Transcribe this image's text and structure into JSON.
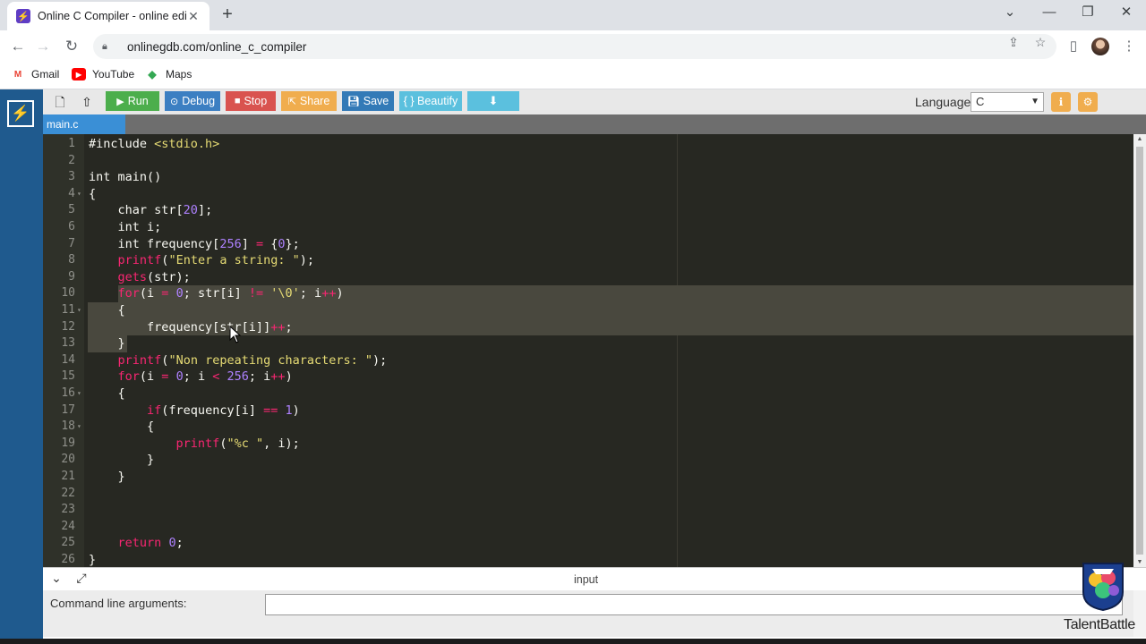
{
  "browser": {
    "tab_title": "Online C Compiler - online editor",
    "tab_close": "✕",
    "new_tab": "+",
    "url": "onlinegdb.com/online_c_compiler",
    "bookmarks": [
      {
        "label": "Gmail",
        "icon": "gmail-icon"
      },
      {
        "label": "YouTube",
        "icon": "youtube-icon"
      },
      {
        "label": "Maps",
        "icon": "maps-icon"
      }
    ],
    "colors": {
      "tabbar": "#dee1e6",
      "omnibox": "#f1f3f4"
    }
  },
  "app": {
    "toolbar": {
      "run": "Run",
      "debug": "Debug",
      "stop": "Stop",
      "share": "Share",
      "save": "Save",
      "beautify": "{ } Beautify",
      "language_label": "Language",
      "language_value": "C"
    },
    "file_tab": "main.c",
    "colors": {
      "sidebar": "#1f5a8e",
      "run": "#4cae4c",
      "debug": "#3c7fc2",
      "stop": "#d9534f",
      "share": "#f0ad4e",
      "save": "#337ab7",
      "beautify": "#5bc0de",
      "download": "#5bc0de",
      "editor_bg": "#272822",
      "selection": "#49483e"
    },
    "editor": {
      "selected_lines": [
        10,
        11,
        12,
        13
      ],
      "lines": [
        {
          "n": "1",
          "fold": "",
          "segs": [
            [
              "k",
              "#include "
            ],
            [
              "str",
              "<stdio.h>"
            ]
          ]
        },
        {
          "n": "2",
          "fold": "",
          "segs": []
        },
        {
          "n": "3",
          "fold": "",
          "segs": [
            [
              "k",
              "int main()"
            ]
          ]
        },
        {
          "n": "4",
          "fold": "▾",
          "segs": [
            [
              "k",
              "{"
            ]
          ]
        },
        {
          "n": "5",
          "fold": "",
          "segs": [
            [
              "k",
              "    char str["
            ],
            [
              "num",
              "20"
            ],
            [
              "k",
              "];"
            ]
          ]
        },
        {
          "n": "6",
          "fold": "",
          "segs": [
            [
              "k",
              "    int i;"
            ]
          ]
        },
        {
          "n": "7",
          "fold": "",
          "segs": [
            [
              "k",
              "    int frequency["
            ],
            [
              "num",
              "256"
            ],
            [
              "k",
              "] "
            ],
            [
              "op",
              "="
            ],
            [
              "k",
              " {"
            ],
            [
              "num",
              "0"
            ],
            [
              "k",
              "};"
            ]
          ]
        },
        {
          "n": "8",
          "fold": "",
          "segs": [
            [
              "k",
              "    "
            ],
            [
              "fn",
              "printf"
            ],
            [
              "k",
              "("
            ],
            [
              "str",
              "\"Enter a string: \""
            ],
            [
              "k",
              ");"
            ]
          ]
        },
        {
          "n": "9",
          "fold": "",
          "segs": [
            [
              "k",
              "    "
            ],
            [
              "fn",
              "gets"
            ],
            [
              "k",
              "(str);"
            ]
          ]
        },
        {
          "n": "10",
          "fold": "",
          "segs": [
            [
              "k",
              "    "
            ],
            [
              "kw",
              "for"
            ],
            [
              "k",
              "(i "
            ],
            [
              "op",
              "="
            ],
            [
              "k",
              " "
            ],
            [
              "num",
              "0"
            ],
            [
              "k",
              "; str[i] "
            ],
            [
              "op",
              "!="
            ],
            [
              "k",
              " "
            ],
            [
              "str",
              "'\\0'"
            ],
            [
              "k",
              "; i"
            ],
            [
              "op",
              "++"
            ],
            [
              "k",
              ")"
            ]
          ]
        },
        {
          "n": "11",
          "fold": "▾",
          "segs": [
            [
              "k",
              "    {"
            ]
          ]
        },
        {
          "n": "12",
          "fold": "",
          "segs": [
            [
              "k",
              "        frequency[str[i]]"
            ],
            [
              "op",
              "++"
            ],
            [
              "k",
              ";"
            ]
          ]
        },
        {
          "n": "13",
          "fold": "",
          "segs": [
            [
              "k",
              "    }"
            ]
          ]
        },
        {
          "n": "14",
          "fold": "",
          "segs": [
            [
              "k",
              "    "
            ],
            [
              "fn",
              "printf"
            ],
            [
              "k",
              "("
            ],
            [
              "str",
              "\"Non repeating characters: \""
            ],
            [
              "k",
              ");"
            ]
          ]
        },
        {
          "n": "15",
          "fold": "",
          "segs": [
            [
              "k",
              "    "
            ],
            [
              "kw",
              "for"
            ],
            [
              "k",
              "(i "
            ],
            [
              "op",
              "="
            ],
            [
              "k",
              " "
            ],
            [
              "num",
              "0"
            ],
            [
              "k",
              "; i "
            ],
            [
              "op",
              "<"
            ],
            [
              "k",
              " "
            ],
            [
              "num",
              "256"
            ],
            [
              "k",
              "; i"
            ],
            [
              "op",
              "++"
            ],
            [
              "k",
              ")"
            ]
          ]
        },
        {
          "n": "16",
          "fold": "▾",
          "segs": [
            [
              "k",
              "    {"
            ]
          ]
        },
        {
          "n": "17",
          "fold": "",
          "segs": [
            [
              "k",
              "        "
            ],
            [
              "kw",
              "if"
            ],
            [
              "k",
              "(frequency[i] "
            ],
            [
              "op",
              "=="
            ],
            [
              "k",
              " "
            ],
            [
              "num",
              "1"
            ],
            [
              "k",
              ")"
            ]
          ]
        },
        {
          "n": "18",
          "fold": "▾",
          "segs": [
            [
              "k",
              "        {"
            ]
          ]
        },
        {
          "n": "19",
          "fold": "",
          "segs": [
            [
              "k",
              "            "
            ],
            [
              "fn",
              "printf"
            ],
            [
              "k",
              "("
            ],
            [
              "str",
              "\"%c \""
            ],
            [
              "k",
              ", i);"
            ]
          ]
        },
        {
          "n": "20",
          "fold": "",
          "segs": [
            [
              "k",
              "        }"
            ]
          ]
        },
        {
          "n": "21",
          "fold": "",
          "segs": [
            [
              "k",
              "    }"
            ]
          ]
        },
        {
          "n": "22",
          "fold": "",
          "segs": []
        },
        {
          "n": "23",
          "fold": "",
          "segs": []
        },
        {
          "n": "24",
          "fold": "",
          "segs": []
        },
        {
          "n": "25",
          "fold": "",
          "segs": [
            [
              "k",
              "    "
            ],
            [
              "fn",
              "return"
            ],
            [
              "k",
              " "
            ],
            [
              "num",
              "0"
            ],
            [
              "k",
              ";"
            ]
          ]
        },
        {
          "n": "26",
          "fold": "",
          "segs": [
            [
              "k",
              "}"
            ]
          ]
        }
      ]
    },
    "bottom": {
      "input_label": "input",
      "cla_label": "Command line arguments:"
    }
  },
  "watermark": {
    "text": "TalentBattle"
  }
}
